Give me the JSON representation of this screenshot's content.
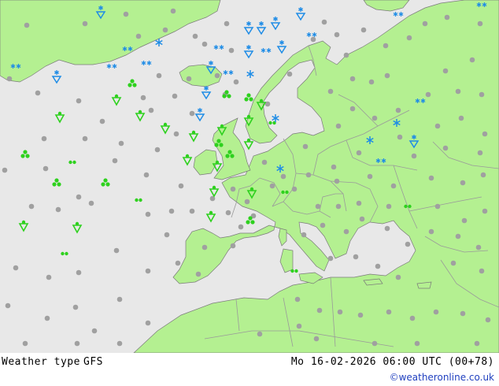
{
  "footer": {
    "title": "Weather type",
    "model": "GFS",
    "datetime": "Mo 16-02-2026 06:00 UTC (00+78)",
    "credit": "©weatheronline.co.uk"
  },
  "colors": {
    "sea": "#e8e8e8",
    "land": "#b4f091",
    "border": "#9a9a9a",
    "coast": "#7a7a7a",
    "dot": "#a0a0a0",
    "rain": "#2ed11e",
    "snow": "#1e8ce6"
  },
  "legend_symbols": {
    "dot": "no-significant-weather",
    "drizzle": "drizzle-icon",
    "rain_shower": "rain-shower-icon",
    "rain": "rain-icon",
    "snow": "snow-icon",
    "snow_shower": "snow-shower-icon"
  }
}
